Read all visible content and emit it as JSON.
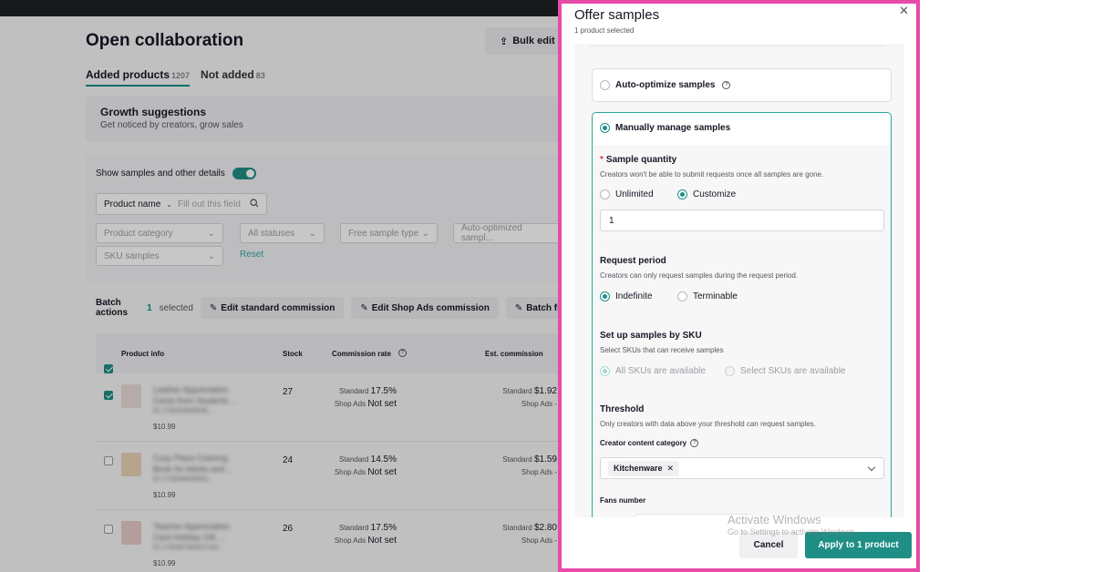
{
  "page": {
    "title": "Open collaboration",
    "bulk_edit": "Bulk edit",
    "tabs": [
      {
        "label": "Added products",
        "count": "1207"
      },
      {
        "label": "Not added",
        "count": "83"
      }
    ],
    "growth": {
      "title": "Growth suggestions",
      "subtitle": "Get noticed by creators, grow sales"
    },
    "show_samples_label": "Show samples and other details",
    "search": {
      "select": "Product name",
      "placeholder": "Fill out this field"
    },
    "filters": {
      "product_category": "Product category",
      "all_statuses": "All statuses",
      "free_sample_type": "Free sample type",
      "auto_optimized": "Auto-optimized sampl...",
      "sku_samples": "SKU samples",
      "reset": "Reset"
    },
    "batch": {
      "label": "Batch actions",
      "count": "1",
      "selected": "selected",
      "edit_standard": "Edit standard commission",
      "edit_shop_ads": "Edit Shop Ads commission",
      "batch_free": "Batch fr"
    },
    "table": {
      "headers": {
        "product": "Product info",
        "stock": "Stock",
        "commission": "Commission rate",
        "est": "Est. commission"
      },
      "rows": [
        {
          "name": "Leather Appreciation Cards from Students ...",
          "sku": "ID 1730283009038...",
          "price": "$10.99",
          "stock": "27",
          "std_label": "Standard",
          "std_rate": "17.5%",
          "ads_label": "Shop Ads",
          "ads_rate": "Not set",
          "est_std": "$1.92",
          "est_ads": "Shop Ads -",
          "checked": true
        },
        {
          "name": "Cozy Place Coloring Book for Adults and...",
          "sku": "ID 1729049093933...",
          "price": "$10.99",
          "stock": "24",
          "std_label": "Standard",
          "std_rate": "14.5%",
          "ads_label": "Shop Ads",
          "ads_rate": "Not set",
          "est_std": "$1.59",
          "est_ads": "Shop Ads -",
          "checked": false
        },
        {
          "name": "Teacher Appreciation Card Holiday Gift ...",
          "sku": "ID 1729287590537182...",
          "price": "$10.99",
          "stock": "26",
          "std_label": "Standard",
          "std_rate": "17.5%",
          "ads_label": "Shop Ads",
          "ads_rate": "Not set",
          "est_std": "$2.80",
          "est_ads": "Shop Ads -",
          "checked": false
        }
      ]
    }
  },
  "modal": {
    "title": "Offer samples",
    "subtitle": "1 product selected",
    "auto_optimize": "Auto-optimize samples",
    "manual": "Manually manage samples",
    "sample_quantity": {
      "label": "Sample quantity",
      "desc": "Creators won't be able to submit requests once all samples are gone.",
      "unlimited": "Unlimited",
      "customize": "Customize",
      "value": "1"
    },
    "request_period": {
      "label": "Request period",
      "desc": "Creators can only request samples during the request period.",
      "indefinite": "Indefinite",
      "terminable": "Terminable"
    },
    "sku": {
      "label": "Set up samples by SKU",
      "desc": "Select SKUs that can receive samples",
      "all": "All SKUs are available",
      "select": "Select SKUs are available"
    },
    "threshold": {
      "label": "Threshold",
      "desc": "Only creators with data above your threshold can request samples.",
      "category_label": "Creator content category",
      "category_tag": "Kitchenware",
      "fans_label": "Fans number"
    },
    "cancel": "Cancel",
    "apply": "Apply to 1 product"
  },
  "watermark": {
    "line1": "Activate Windows",
    "line2": "Go to Settings to activate Windows."
  },
  "colors": {
    "accent": "#1f8f86",
    "highlight_border": "#e84aa9",
    "required": "#e83a5a"
  }
}
